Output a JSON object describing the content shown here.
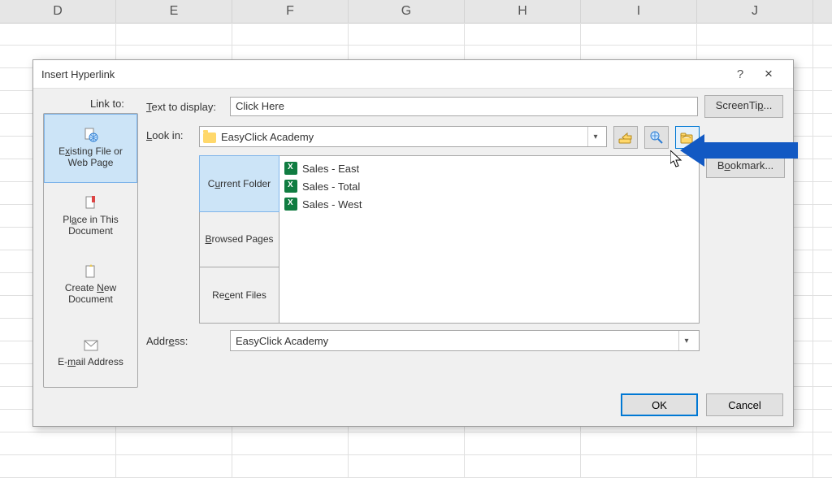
{
  "columns": [
    "D",
    "E",
    "F",
    "G",
    "H",
    "I",
    "J"
  ],
  "dialog": {
    "title": "Insert Hyperlink",
    "help": "?",
    "close": "×",
    "link_to_label": "Link to:",
    "text_display_label": "Text to display:",
    "text_display_value": "Click Here",
    "screentip_label": "ScreenTip...",
    "lookin_label": "Look in:",
    "lookin_value": "EasyClick Academy",
    "bookmark_label": "Bookmark...",
    "address_label": "Address:",
    "address_value": "EasyClick Academy",
    "ok_label": "OK",
    "cancel_label": "Cancel",
    "link_targets": [
      {
        "label_html": "E<u>x</u>isting File or Web Page",
        "icon": "globe-page"
      },
      {
        "label_html": "Pl<u>a</u>ce in This Document",
        "icon": "doc-bookmark"
      },
      {
        "label_html": "Create <u>N</u>ew Document",
        "icon": "doc-new"
      },
      {
        "label_html": "E-<u>m</u>ail Address",
        "icon": "mail"
      }
    ],
    "browse_tabs": [
      {
        "label_html": "C<u>u</u>rrent Folder"
      },
      {
        "label_html": "<u>B</u>rowsed Pages"
      },
      {
        "label_html": "Re<u>c</u>ent Files"
      }
    ],
    "files": [
      {
        "name": "Sales - East"
      },
      {
        "name": "Sales - Total"
      },
      {
        "name": "Sales - West"
      }
    ]
  },
  "colors": {
    "accent": "#0078d4",
    "arrow": "#1259c3"
  }
}
